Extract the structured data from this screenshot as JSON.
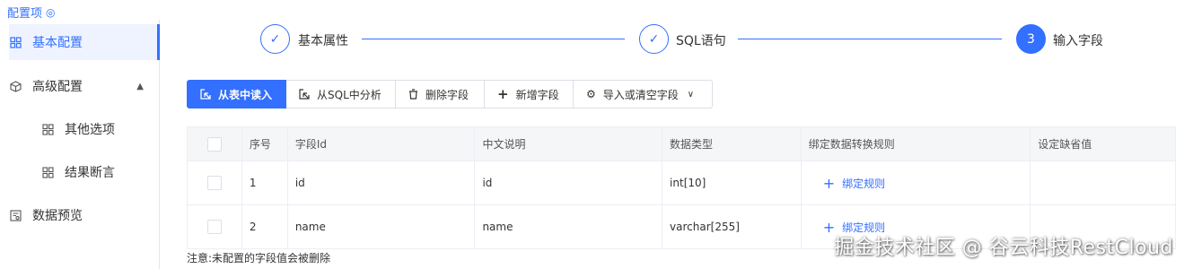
{
  "header": {
    "title": "配置项",
    "icon": "settings-icon"
  },
  "sidebar": {
    "items": [
      {
        "label": "基本配置",
        "icon": "grid-icon",
        "active": true
      },
      {
        "label": "高级配置",
        "icon": "cube-icon",
        "expanded": true
      },
      {
        "label": "其他选项",
        "icon": "grid-icon"
      },
      {
        "label": "结果断言",
        "icon": "grid-icon"
      },
      {
        "label": "数据预览",
        "icon": "preview-icon"
      }
    ]
  },
  "steps": [
    {
      "label": "基本属性",
      "state": "done"
    },
    {
      "label": "SQL语句",
      "state": "done"
    },
    {
      "label": "输入字段",
      "number": "3",
      "state": "current"
    }
  ],
  "toolbar": {
    "read_from_table": "从表中读入",
    "analyze_sql": "从SQL中分析",
    "delete_field": "删除字段",
    "add_field": "新增字段",
    "import_clear": "导入或清空字段"
  },
  "table": {
    "headers": [
      "序号",
      "字段Id",
      "中文说明",
      "数据类型",
      "绑定数据转换规则",
      "设定缺省值"
    ],
    "rows": [
      {
        "index": "1",
        "field_id": "id",
        "description": "id",
        "data_type": "int[10]",
        "rule": "绑定规则",
        "default": ""
      },
      {
        "index": "2",
        "field_id": "name",
        "description": "name",
        "data_type": "varchar[255]",
        "rule": "绑定规则",
        "default": ""
      }
    ]
  },
  "note": "注意:未配置的字段值会被删除",
  "watermark": "掘金技术社区 @ 谷云科技RestCloud",
  "colors": {
    "accent": "#3370ff",
    "active_bg": "#eef3ff",
    "border": "#ebeef5"
  }
}
